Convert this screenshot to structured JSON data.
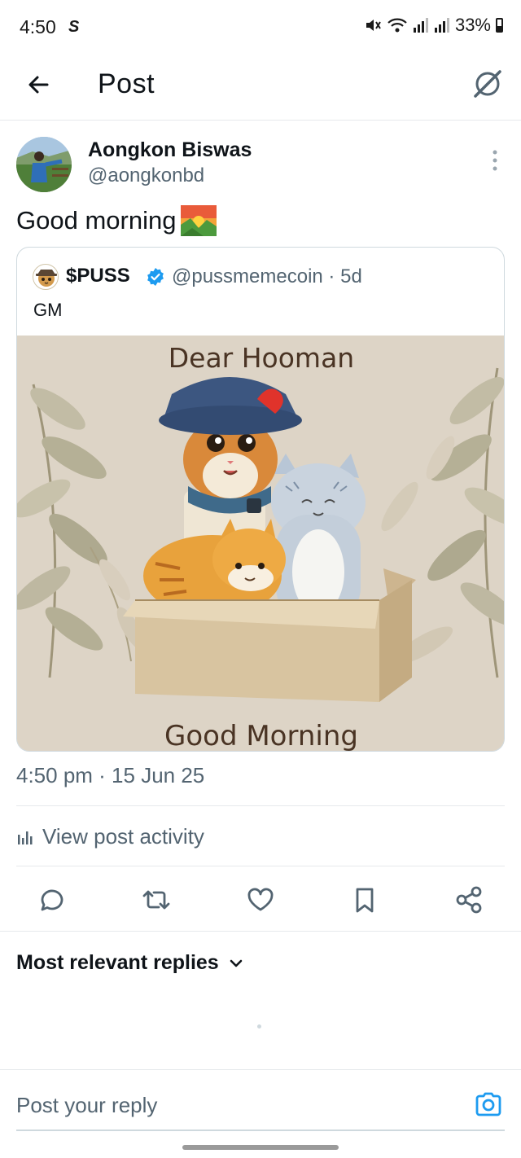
{
  "status_bar": {
    "time": "4:50",
    "carrier_icon": "S",
    "battery": "33%",
    "icons": [
      "mute-icon",
      "wifi-icon",
      "signal-icon",
      "signal-icon",
      "battery-icon"
    ]
  },
  "header": {
    "title": "Post",
    "back_icon": "arrow-left-icon",
    "grok_icon": "grok-icon"
  },
  "post": {
    "author_name": "Aongkon Biswas",
    "author_handle": "@aongkonbd",
    "text": "Good morning",
    "emoji": "sunrise-over-mountains",
    "timestamp": "4:50 pm · 15 Jun 25"
  },
  "quote": {
    "name": "$PUSS",
    "handle_time": "@pussmemecoin · 5d",
    "text": "GM",
    "image": {
      "top_text": "Dear Hooman",
      "bottom_text": "Good Morning"
    }
  },
  "activity": {
    "label": "View post activity"
  },
  "actions": [
    "reply-icon",
    "repost-icon",
    "like-icon",
    "bookmark-icon",
    "share-icon"
  ],
  "replies": {
    "sort_label": "Most relevant replies"
  },
  "reply_bar": {
    "placeholder": "Post your reply"
  },
  "colors": {
    "text": "#0f1419",
    "secondary": "#536471",
    "accent": "#1d9bf0",
    "border": "#cfd9de",
    "image_bg": "#ddd4c6",
    "image_text": "#4a3424"
  }
}
